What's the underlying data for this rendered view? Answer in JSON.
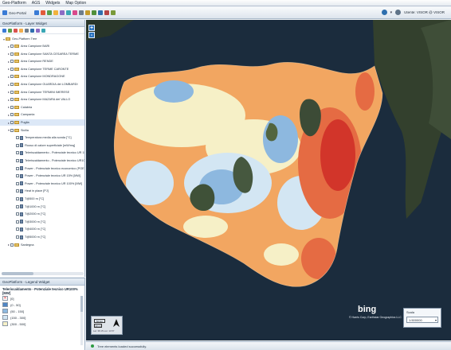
{
  "menubar": {
    "items": [
      "Geo-Platform",
      "AGS",
      "Widgets",
      "Map Option"
    ]
  },
  "toolbar": {
    "home_label": "Geo-Portal",
    "user_label": "Utente: VISOR @ VISOR",
    "colors": [
      "#3a7bd5",
      "#e25b3b",
      "#57a04c",
      "#f2b33d",
      "#8c6bc4",
      "#3aa7b5",
      "#d94a8c",
      "#6e7d8c",
      "#c59b2b",
      "#4f8f3a",
      "#2f6fae",
      "#b54545",
      "#7a9a3a"
    ]
  },
  "layer_panel": {
    "title": "GeoPlatform - Layer Widget",
    "root_label": "Geo-Platform Tree",
    "items": [
      {
        "label": "Area Campione BARI",
        "kind": "folder"
      },
      {
        "label": "Area Campione SANTA CESAREA TERME",
        "kind": "folder"
      },
      {
        "label": "Area Campione RENDE",
        "kind": "folder"
      },
      {
        "label": "Area Campione TERME CARONTE",
        "kind": "folder"
      },
      {
        "label": "Area Campione MONDRAGONE",
        "kind": "folder"
      },
      {
        "label": "Area Campione GUARDIA dei LOMBARDI",
        "kind": "folder"
      },
      {
        "label": "Area Campione TERMINI IMERESE",
        "kind": "folder"
      },
      {
        "label": "Area Campione MAZARA del VALLO",
        "kind": "folder"
      },
      {
        "label": "Calabria",
        "kind": "folder"
      },
      {
        "label": "Campania",
        "kind": "folder"
      },
      {
        "label": "Puglia",
        "kind": "folder",
        "selected": true
      },
      {
        "label": "Sicilia",
        "kind": "folder-open"
      },
      {
        "label": "Temperatura media alla sonda [°C]",
        "kind": "layer"
      },
      {
        "label": "Flusso di calore superficiale [mW/mq]",
        "kind": "layer"
      },
      {
        "label": "Teleriscaldamento - Potenziale tecnico UR 15% [MW]",
        "kind": "layer"
      },
      {
        "label": "Teleriscaldamento - Potenziale tecnico UR100% [MW]",
        "kind": "layer"
      },
      {
        "label": "Power - Potenziale tecnico economico (PGE) [MW]",
        "kind": "layer"
      },
      {
        "label": "Power - Potenziale tecnico UR 15% [MW]",
        "kind": "layer"
      },
      {
        "label": "Power - Potenziale tecnico UR 100% [MW]",
        "kind": "layer"
      },
      {
        "label": "Heat in place [PJ]",
        "kind": "layer"
      },
      {
        "label": "T@500 m [°C]",
        "kind": "layer"
      },
      {
        "label": "T@1000 m [°C]",
        "kind": "layer"
      },
      {
        "label": "T@2000 m [°C]",
        "kind": "layer"
      },
      {
        "label": "T@3000 m [°C]",
        "kind": "layer"
      },
      {
        "label": "T@4000 m [°C]",
        "kind": "layer"
      },
      {
        "label": "T@5000 m [°C]",
        "kind": "layer"
      },
      {
        "label": "Sardegna",
        "kind": "folder"
      }
    ]
  },
  "legend_panel": {
    "title": "GeoPlatform - Legend Widget",
    "layer_name": "Teleriscaldamento - Potenziale tecnico UR100% [MW]",
    "entries": [
      {
        "label": "[0]",
        "color": "#ffffff",
        "cross": true
      },
      {
        "label": "(0 - 50]",
        "color": "#4f86c6"
      },
      {
        "label": "(50 - 150]",
        "color": "#8db8df"
      },
      {
        "label": "(150 - 300]",
        "color": "#d3e6f3"
      },
      {
        "label": "(300 - 500]",
        "color": "#f6f0c7"
      }
    ]
  },
  "map": {
    "zoom_in": "+",
    "zoom_out": "-",
    "scale_lines": [
      "50 km",
      "30 mi"
    ],
    "coords": "Lat: 38.15 Lon: 13.57",
    "provider": "bing",
    "attribution": "© Harris Corp, Earthstar Geographics LLC",
    "scale_widget": {
      "title": "Scala",
      "value": "1:500000"
    },
    "colors": {
      "sea": "#1b2c3d",
      "very_low": "#8db8df",
      "low": "#d3e6f3",
      "mid": "#f6f0c7",
      "orange": "#f2a661",
      "high": "#e56b43",
      "very_high": "#d2352a"
    }
  },
  "status": {
    "message": "Tree elements loaded successfully."
  }
}
